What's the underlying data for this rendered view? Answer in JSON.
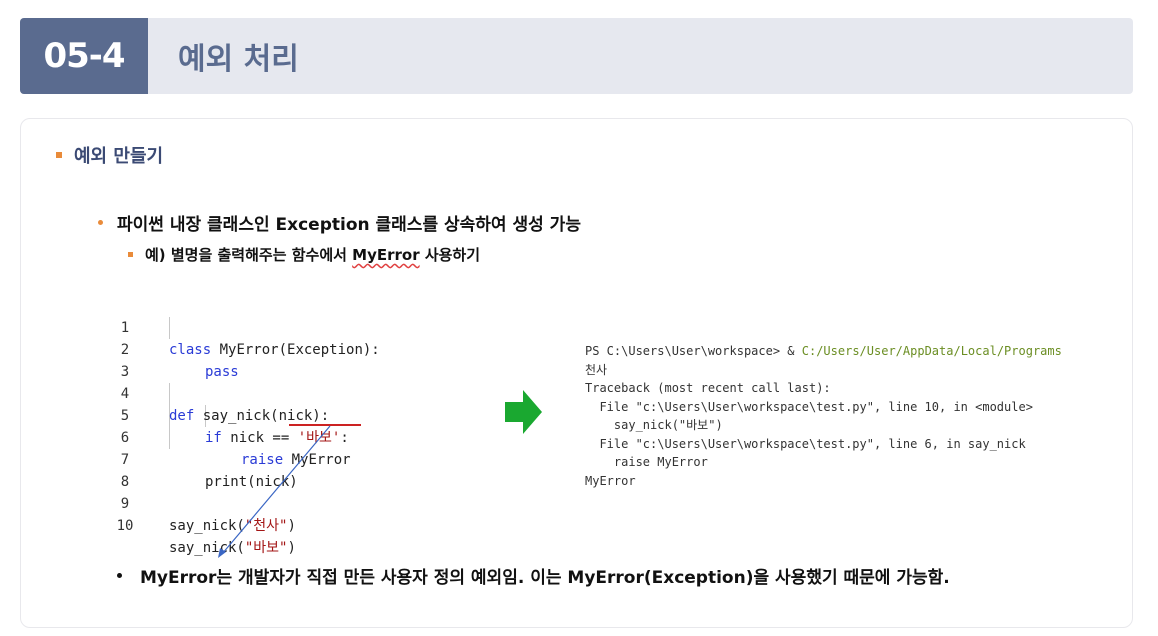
{
  "header": {
    "number": "05-4",
    "title": "예외 처리"
  },
  "section": {
    "title": "예외 만들기"
  },
  "bullet1": {
    "text": "파이썬 내장 클래스인 Exception 클래스를 상속하여 생성 가능"
  },
  "bullet2": {
    "prefix": "예) 별명을 출력해주는 함수에서 ",
    "highlight": "MyError",
    "suffix": " 사용하기"
  },
  "code": {
    "line_numbers": [
      "1",
      "2",
      "3",
      "4",
      "5",
      "6",
      "7",
      "8",
      "9",
      "10"
    ],
    "l1": {
      "kw": "class",
      "rest": " MyError(Exception):"
    },
    "l2": {
      "kw": "pass"
    },
    "l4": {
      "kw": "def",
      "rest": " say_nick(nick):"
    },
    "l5": {
      "kw": "if",
      "mid": " nick == ",
      "str": "'바보'",
      "end": ":"
    },
    "l6": {
      "kw": "raise",
      "rest": " MyError"
    },
    "l7": {
      "text": "print(nick)"
    },
    "l9": {
      "pre": "say_nick(",
      "str": "\"천사\"",
      "end": ")"
    },
    "l10": {
      "pre": "say_nick(",
      "str": "\"바보\"",
      "end": ")"
    }
  },
  "terminal": {
    "line1_prompt": "PS C:\\Users\\User\\workspace> & ",
    "line1_path": "C:/Users/User/AppData/Local/Programs",
    "line2": "천사",
    "line3": "Traceback (most recent call last):",
    "line4": "  File \"c:\\Users\\User\\workspace\\test.py\", line 10, in <module>",
    "line5": "    say_nick(\"바보\")",
    "line6": "  File \"c:\\Users\\User\\workspace\\test.py\", line 6, in say_nick",
    "line7": "    raise MyError",
    "line8": "MyError"
  },
  "note": {
    "text": "MyError는 개발자가 직접 만든 사용자 정의 예외임. 이는 MyError(Exception)을 사용했기 때문에 가능함."
  },
  "colors": {
    "accent": "#5a6b8f",
    "bullet": "#e98b3a",
    "keyword": "#2a3bd6",
    "string": "#a31515",
    "arrow": "#1aa830",
    "line": "#3a66c4"
  }
}
